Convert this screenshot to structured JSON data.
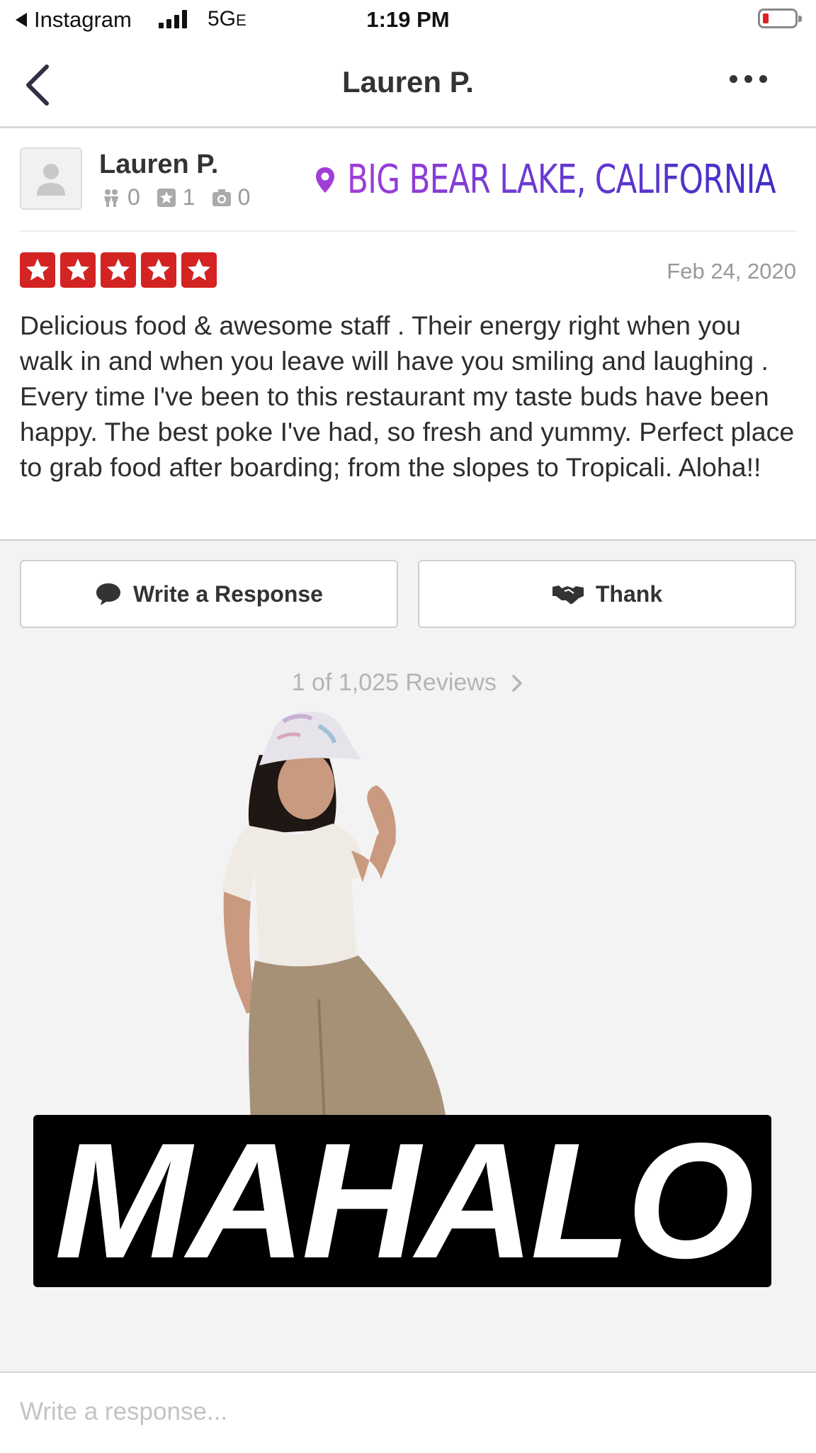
{
  "status_bar": {
    "back_app": "Instagram",
    "network": "5G",
    "network_suffix": "E",
    "time": "1:19 PM"
  },
  "nav": {
    "title": "Lauren P."
  },
  "reviewer": {
    "name": "Lauren P.",
    "friends": "0",
    "reviews": "1",
    "photos": "0"
  },
  "location_sticker": "BIG BEAR LAKE, CALIFORNIA",
  "review": {
    "rating": 5,
    "rating_max": 5,
    "date": "Feb 24, 2020",
    "text": "Delicious food & awesome staff . Their energy right when you walk in and when you leave will have you smiling and laughing . Every time I've been to this restaurant my taste buds have been happy. The best poke I've had, so fresh and yummy. Perfect place to grab food after boarding; from the slopes to Tropicali. Aloha!!"
  },
  "actions": {
    "respond_label": "Write a Response",
    "thank_label": "Thank"
  },
  "pagination": {
    "label": "1 of 1,025 Reviews"
  },
  "mahalo_sticker": "MAHALO",
  "response_input": {
    "placeholder": "Write a response...",
    "value": ""
  },
  "colors": {
    "star_red": "#d32323",
    "location_purple": "#a13ed8",
    "location_blue": "#3f2fc6",
    "battery_low": "#e02020"
  }
}
